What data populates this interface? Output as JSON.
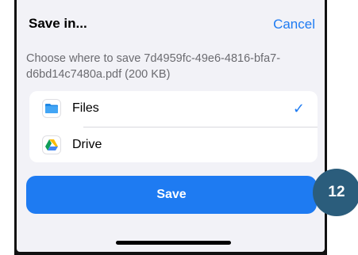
{
  "sheet": {
    "title": "Save in...",
    "cancel_label": "Cancel",
    "description": "Choose where to save 7d4959fc-49e6-4816-bfa7-d6bd14c7480a.pdf (200 KB)"
  },
  "destinations": [
    {
      "label": "Files",
      "icon": "files-folder-icon",
      "selected": true,
      "check": "✓"
    },
    {
      "label": "Drive",
      "icon": "google-drive-icon",
      "selected": false
    }
  ],
  "save_button": {
    "label": "Save"
  },
  "step_badge": {
    "number": "12"
  },
  "colors": {
    "accent": "#1e7bf2",
    "sheet_background": "#f2f2f7",
    "badge": "#2b5d7c",
    "folder_blue": "#1e88e5"
  }
}
